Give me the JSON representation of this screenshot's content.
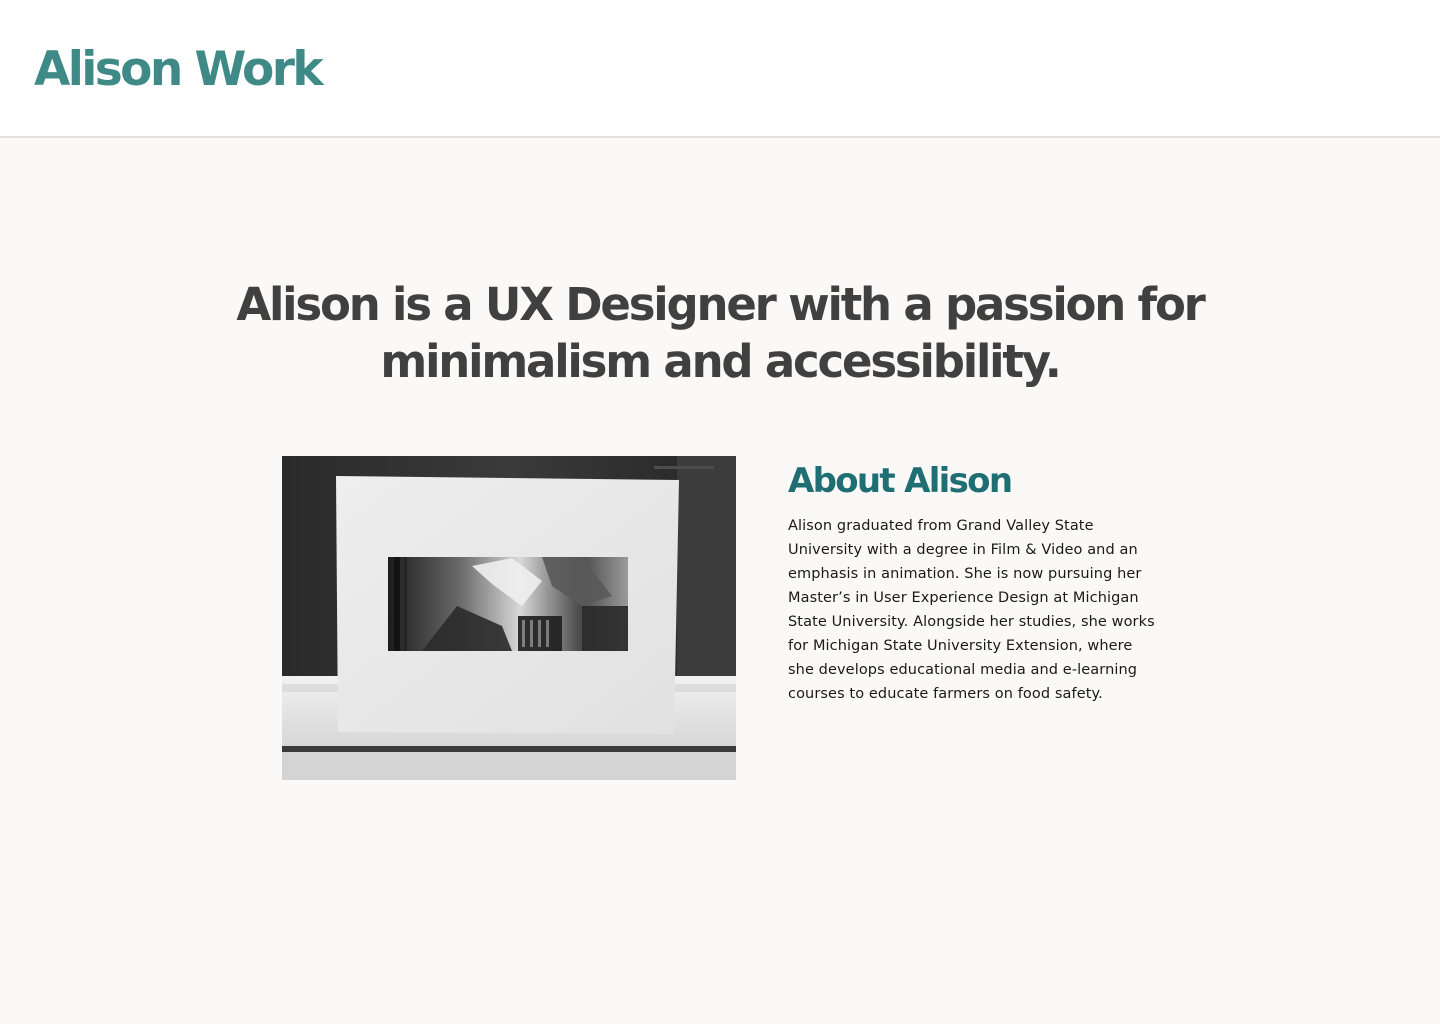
{
  "header": {
    "site_title": "Alison Work",
    "accent_color": "#3f8a87"
  },
  "hero": {
    "heading": "Alison is a UX Designer with a passion for minimalism and accessibility."
  },
  "photo": {
    "description_icon": "framed-photo-image"
  },
  "about": {
    "title": "About Alison",
    "title_color": "#1f6e73",
    "body": "Alison graduated from Grand Valley State University with a degree in Film & Video and an emphasis in animation. She is now pursuing her Master’s in User Experience Design at Michigan State University. Alongside her studies, she works for Michigan State University Extension, where she develops educational media and e-learning courses to educate farmers on food safety."
  }
}
